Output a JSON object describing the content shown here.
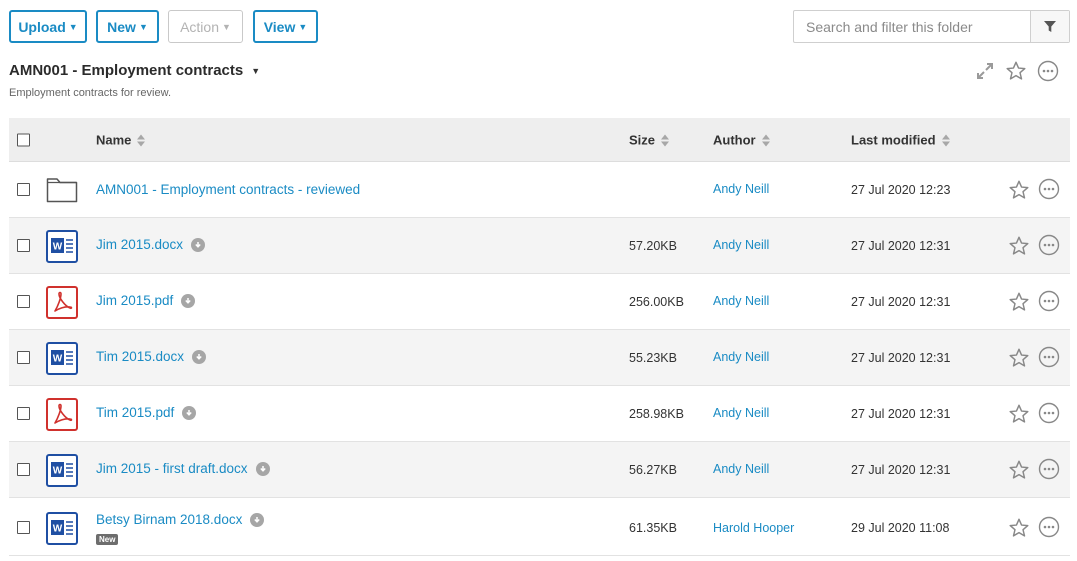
{
  "toolbar": {
    "upload_label": "Upload",
    "new_label": "New",
    "action_label": "Action",
    "view_label": "View",
    "search_placeholder": "Search and filter this folder"
  },
  "folder": {
    "title": "AMN001 - Employment contracts",
    "description": "Employment contracts for review."
  },
  "columns": {
    "name": "Name",
    "size": "Size",
    "author": "Author",
    "modified": "Last modified"
  },
  "rows": [
    {
      "type": "folder",
      "name": "AMN001 - Employment contracts - reviewed",
      "size": "",
      "author": "Andy Neill",
      "modified": "27 Jul 2020 12:23"
    },
    {
      "type": "word",
      "name": "Jim 2015.docx",
      "size": "57.20KB",
      "author": "Andy Neill",
      "modified": "27 Jul 2020 12:31"
    },
    {
      "type": "pdf",
      "name": "Jim 2015.pdf",
      "size": "256.00KB",
      "author": "Andy Neill",
      "modified": "27 Jul 2020 12:31"
    },
    {
      "type": "word",
      "name": "Tim 2015.docx",
      "size": "55.23KB",
      "author": "Andy Neill",
      "modified": "27 Jul 2020 12:31"
    },
    {
      "type": "pdf",
      "name": "Tim 2015.pdf",
      "size": "258.98KB",
      "author": "Andy Neill",
      "modified": "27 Jul 2020 12:31"
    },
    {
      "type": "word",
      "name": "Jim 2015 - first draft.docx",
      "size": "56.27KB",
      "author": "Andy Neill",
      "modified": "27 Jul 2020 12:31"
    },
    {
      "type": "word",
      "name": "Betsy Birnam 2018.docx",
      "size": "61.35KB",
      "author": "Harold Hooper",
      "modified": "29 Jul 2020 11:08",
      "badge": "New"
    }
  ],
  "colors": {
    "accent": "#1a8bc4",
    "word_blue": "#1f4fa3",
    "pdf_red": "#d0312d",
    "header_bg": "#eeeeee",
    "alt_row_bg": "#f4f4f4"
  },
  "icons": {
    "folder": "folder-icon",
    "word": "word-doc-icon",
    "pdf": "pdf-icon",
    "download": "download-icon",
    "favorite": "star-icon",
    "more": "more-options-icon",
    "fullscreen": "expand-icon",
    "filter": "filter-icon"
  }
}
